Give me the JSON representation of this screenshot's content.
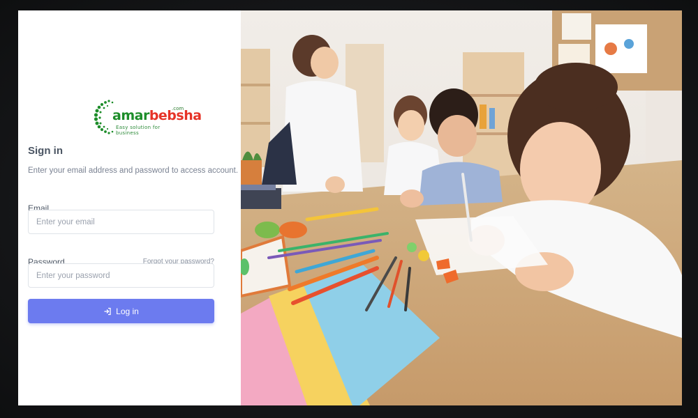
{
  "brand": {
    "name_part1": "amar",
    "name_part2": "bebsha",
    "domain_suffix": ".com",
    "tagline": "Easy solution for business",
    "colors": {
      "green": "#1d8d2a",
      "red": "#e63327"
    }
  },
  "signin": {
    "title": "Sign in",
    "subtitle": "Enter your email address and password to access account.",
    "email_label": "Email",
    "email_placeholder": "Enter your email",
    "email_value": "",
    "password_label": "Password",
    "password_placeholder": "Enter your password",
    "password_value": "",
    "forgot_link": "Forgot your password?",
    "login_button": "Log in",
    "login_icon": "login-icon",
    "accent_color": "#6c7bef"
  },
  "hero": {
    "image": "classroom-children-drawing-photo"
  }
}
